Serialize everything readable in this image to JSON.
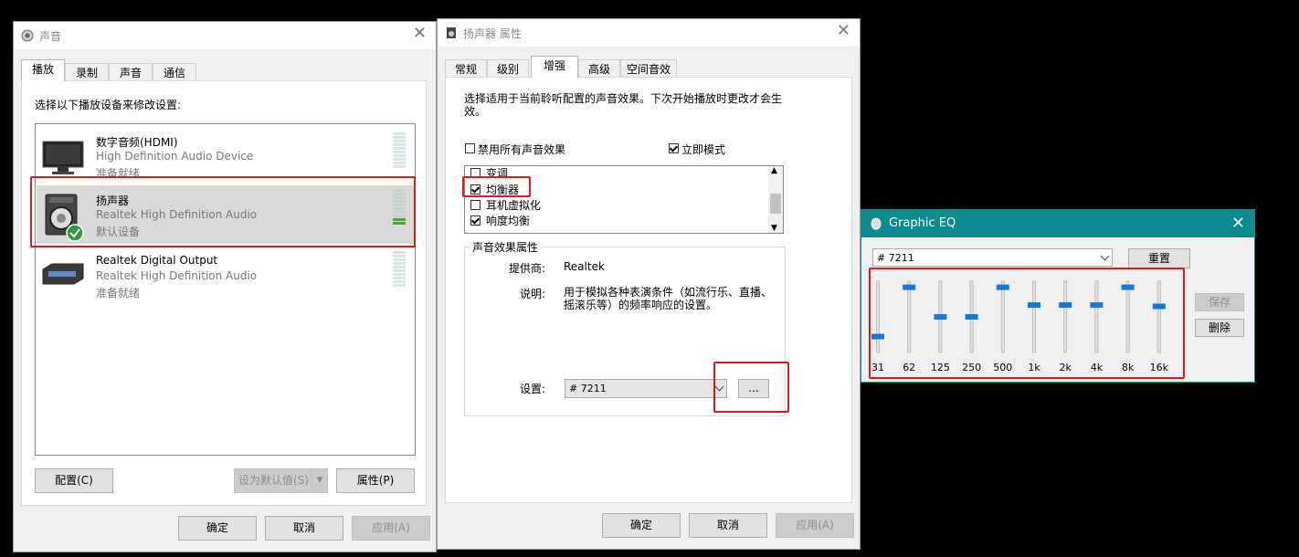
{
  "sound_window": {
    "title": "声音",
    "tabs": [
      "播放",
      "录制",
      "声音",
      "通信"
    ],
    "instruction": "选择以下播放设备来修改设置:",
    "devices": [
      {
        "name": "数字音频(HDMI)",
        "driver": "High Definition Audio Device",
        "status": "准备就绪",
        "icon": "monitor-icon"
      },
      {
        "name": "扬声器",
        "driver": "Realtek High Definition Audio",
        "status": "默认设备",
        "icon": "speaker-icon",
        "selected": true
      },
      {
        "name": "Realtek Digital Output",
        "driver": "Realtek High Definition Audio",
        "status": "准备就绪",
        "icon": "digital-output-icon"
      }
    ],
    "buttons": {
      "configure": "配置(C)",
      "set_default": "设为默认值(S)",
      "properties": "属性(P)",
      "ok": "确定",
      "cancel": "取消",
      "apply": "应用(A)"
    }
  },
  "speaker_props": {
    "title": "扬声器 属性",
    "tabs": [
      "常规",
      "级别",
      "增强",
      "高级",
      "空间音效"
    ],
    "description": "选择适用于当前聆听配置的声音效果。下次开始播放时更改才会生效。",
    "disable_all_label": "禁用所有声音效果",
    "immediate_mode_label": "立即模式",
    "effects": [
      {
        "label": "变调",
        "checked": false
      },
      {
        "label": "均衡器",
        "checked": true
      },
      {
        "label": "耳机虚拟化",
        "checked": false
      },
      {
        "label": "响度均衡",
        "checked": true
      }
    ],
    "group_title": "声音效果属性",
    "provider_label": "提供商:",
    "provider_value": "Realtek",
    "explain_label": "说明:",
    "explain_value": "用于模拟各种表演条件（如流行乐、直播、摇滚乐等）的频率响应的设置。",
    "setting_label": "设置:",
    "setting_value": "# 7211",
    "ellipsis": "...",
    "buttons": {
      "ok": "确定",
      "cancel": "取消",
      "apply": "应用(A)"
    }
  },
  "graphic_eq": {
    "title": "Graphic EQ",
    "preset": "# 7211",
    "reset": "重置",
    "save": "保存",
    "delete": "删除",
    "bands": [
      {
        "label": "31",
        "level": 0.2
      },
      {
        "label": "62",
        "level": 0.95
      },
      {
        "label": "125",
        "level": 0.5
      },
      {
        "label": "250",
        "level": 0.5
      },
      {
        "label": "500",
        "level": 0.95
      },
      {
        "label": "1k",
        "level": 0.68
      },
      {
        "label": "2k",
        "level": 0.68
      },
      {
        "label": "4k",
        "level": 0.68
      },
      {
        "label": "8k",
        "level": 0.95
      },
      {
        "label": "16k",
        "level": 0.66
      }
    ]
  },
  "colors": {
    "eq_title_bar": "#0e8a91",
    "highlight": "#e0191b",
    "thumb": "#1677d4",
    "selection": "#d9d9d9"
  }
}
